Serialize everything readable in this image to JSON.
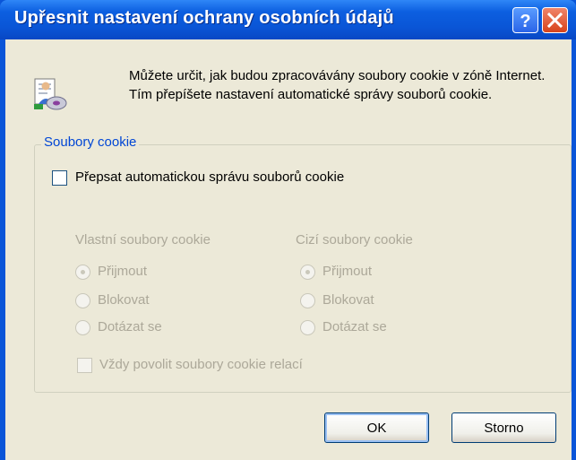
{
  "window": {
    "title": "Upřesnit nastavení ochrany osobních údajů",
    "help_glyph": "?",
    "close_glyph": "✕"
  },
  "intro_text": "Můžete určit, jak budou zpracovávány soubory cookie v zóně Internet. Tím přepíšete nastavení automatické správy souborů cookie.",
  "cookies_group": {
    "legend": "Soubory cookie",
    "override_label": "Přepsat automatickou správu souborů cookie",
    "override_checked": false,
    "first_party": {
      "header": "Vlastní soubory cookie",
      "options": [
        "Přijmout",
        "Blokovat",
        "Dotázat se"
      ],
      "selected": "Přijmout"
    },
    "third_party": {
      "header": "Cizí soubory cookie",
      "options": [
        "Přijmout",
        "Blokovat",
        "Dotázat se"
      ],
      "selected": "Přijmout"
    },
    "session_label": "Vždy povolit soubory cookie relací",
    "session_checked": false,
    "controls_enabled": false
  },
  "buttons": {
    "ok": "OK",
    "cancel": "Storno"
  },
  "icons": [
    "privacy-settings-icon",
    "help-icon",
    "close-icon"
  ],
  "colors": {
    "titlebar": "#0a55d8",
    "dialog_bg": "#ece9d8",
    "legend": "#0046d5",
    "disabled_text": "#aca899"
  }
}
